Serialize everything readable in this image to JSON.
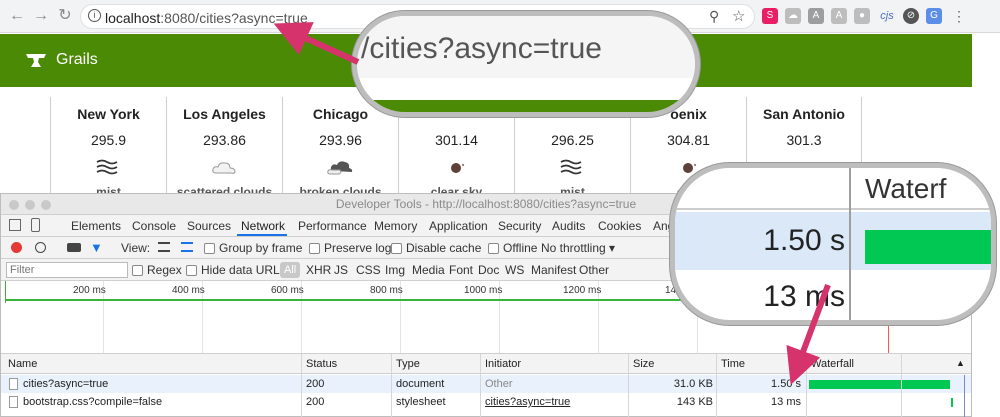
{
  "browser": {
    "url_host": "localhost",
    "url_rest": ":8080/cities?async=true",
    "ext_icons": [
      "star-icon",
      "spinner-icon",
      "cloud-icon",
      "angular-icon",
      "angular-icon",
      "lock-icon",
      "cjs-icon",
      "circle-icon",
      "translate-icon",
      "menu-icon"
    ],
    "cjs_label": "cjs"
  },
  "grails": {
    "name": "Grails"
  },
  "cities": [
    {
      "name": "New York",
      "temp": "295.9",
      "icon": "mist-icon",
      "desc": "mist"
    },
    {
      "name": "Los Angeles",
      "temp": "293.86",
      "icon": "cloud-icon",
      "desc": "scattered clouds"
    },
    {
      "name": "Chicago",
      "temp": "293.96",
      "icon": "broken-cloud-icon",
      "desc": "broken clouds"
    },
    {
      "name": "",
      "temp": "301.14",
      "icon": "clear-sky-icon",
      "desc": "clear sky"
    },
    {
      "name": "",
      "temp": "296.25",
      "icon": "mist-icon",
      "desc": "mist"
    },
    {
      "name": "oenix",
      "temp": "304.81",
      "icon": "clear-sky-icon",
      "desc": "clea"
    },
    {
      "name": "San Antonio",
      "temp": "301.3",
      "icon": "clear-sky-icon",
      "desc": ""
    }
  ],
  "devtools": {
    "title": "Developer Tools - http://localhost:8080/cities?async=true",
    "tabs": [
      "Elements",
      "Console",
      "Sources",
      "Network",
      "Performance",
      "Memory",
      "Application",
      "Security",
      "Audits",
      "Cookies",
      "Ang"
    ],
    "active_tab": "Network",
    "toolbar": {
      "view": "View:",
      "group_by_frame": "Group by frame",
      "preserve_log": "Preserve log",
      "disable_cache": "Disable cache",
      "offline": "Offline",
      "throttling": "No throttling"
    },
    "filter": {
      "placeholder": "Filter",
      "regex": "Regex",
      "hide_data_urls": "Hide data URLs",
      "types": [
        "All",
        "XHR",
        "JS",
        "CSS",
        "Img",
        "Media",
        "Font",
        "Doc",
        "WS",
        "Manifest",
        "Other"
      ]
    },
    "overview_ticks": [
      "200 ms",
      "400 ms",
      "600 ms",
      "800 ms",
      "1000 ms",
      "1200 ms",
      "1400"
    ],
    "columns": [
      "Name",
      "Status",
      "Type",
      "Initiator",
      "Size",
      "Time",
      "Waterfall"
    ],
    "rows": [
      {
        "name": "cities?async=true",
        "status": "200",
        "type": "document",
        "initiator": "Other",
        "size": "31.0 KB",
        "time": "1.50 s",
        "waterfall_start": 0.0,
        "waterfall_len": 0.74
      },
      {
        "name": "bootstrap.css?compile=false",
        "status": "200",
        "type": "stylesheet",
        "initiator": "cities?async=true",
        "size": "143 KB",
        "time": "13 ms",
        "waterfall_start": 0.745,
        "waterfall_len": 0.01
      }
    ]
  },
  "zoom_top": {
    "text": "/cities?async=true"
  },
  "zoom_right": {
    "heading": "Waterf",
    "time1": "1.50 s",
    "time2": "13 ms"
  },
  "colors": {
    "grails_green": "#4a8a04",
    "arrow": "#d6336c",
    "waterfall": "#00c853",
    "selected_row": "#e8f1fc"
  }
}
